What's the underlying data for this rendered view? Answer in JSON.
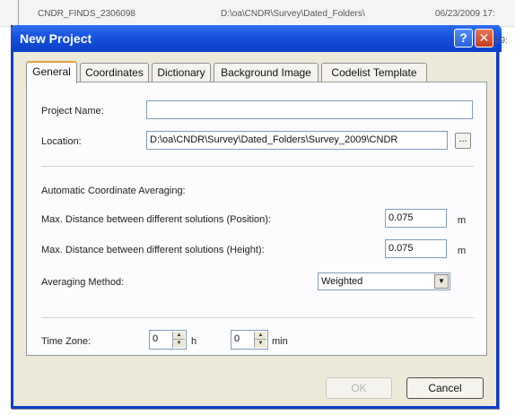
{
  "background_row": {
    "name": "CNDR_FINDS_2306098",
    "path": "D:\\oa\\CNDR\\Survey\\Dated_Folders\\",
    "date": "06/23/2009 17:",
    "time_fragment": "09:"
  },
  "dialog": {
    "title": "New Project",
    "help_glyph": "?",
    "close_glyph": "✕",
    "tabs": [
      "General",
      "Coordinates",
      "Dictionary",
      "Background Image",
      "Codelist Template"
    ],
    "general": {
      "project_name_label": "Project Name:",
      "project_name_value": "",
      "location_label": "Location:",
      "location_value": "D:\\oa\\CNDR\\Survey\\Dated_Folders\\Survey_2009\\CNDR",
      "browse_label": "...",
      "averaging_heading": "Automatic Coordinate Averaging:",
      "max_pos_label": "Max. Distance between different solutions (Position):",
      "max_pos_value": "0.075",
      "max_pos_unit": "m",
      "max_height_label": "Max. Distance between different solutions (Height):",
      "max_height_value": "0.075",
      "max_height_unit": "m",
      "method_label": "Averaging Method:",
      "method_value": "Weighted",
      "timezone_label": "Time Zone:",
      "tz_hours_value": "0",
      "tz_hours_unit": "h",
      "tz_minutes_value": "0",
      "tz_minutes_unit": "min"
    },
    "buttons": {
      "ok": "OK",
      "cancel": "Cancel"
    }
  },
  "colors": {
    "title_bar": "#1650de",
    "dialog_face": "#ece9d8",
    "active_tab_accent": "#e6a338"
  }
}
